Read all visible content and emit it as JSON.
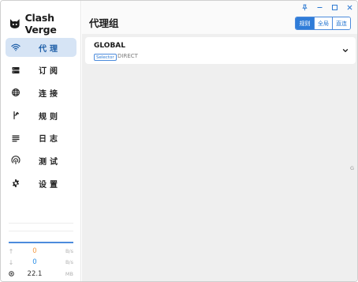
{
  "app": {
    "name": "Clash Verge"
  },
  "sidebar": {
    "items": [
      {
        "label": "代理",
        "icon": "wifi-icon",
        "active": true
      },
      {
        "label": "订阅",
        "icon": "server-icon",
        "active": false
      },
      {
        "label": "连接",
        "icon": "globe-icon",
        "active": false
      },
      {
        "label": "规则",
        "icon": "fork-icon",
        "active": false
      },
      {
        "label": "日志",
        "icon": "list-icon",
        "active": false
      },
      {
        "label": "测试",
        "icon": "radar-icon",
        "active": false
      },
      {
        "label": "设置",
        "icon": "gear-icon",
        "active": false
      }
    ],
    "traffic": {
      "upload": {
        "value": "0",
        "unit": "B/s",
        "color": "#f39a44"
      },
      "download": {
        "value": "0",
        "unit": "B/s",
        "color": "#2a8ee6"
      },
      "memory": {
        "value": "22.1",
        "unit": "MB"
      }
    }
  },
  "header": {
    "title": "代理组",
    "modes": [
      {
        "label": "规则",
        "active": true
      },
      {
        "label": "全局",
        "active": false
      },
      {
        "label": "直连",
        "active": false
      }
    ]
  },
  "groups": [
    {
      "name": "GLOBAL",
      "type": "Selector",
      "now": "DIRECT"
    }
  ],
  "side_letter": "G",
  "colors": {
    "accent": "#2f7cd8",
    "active_nav_bg": "#d6e4f5",
    "main_bg": "#efefef"
  }
}
